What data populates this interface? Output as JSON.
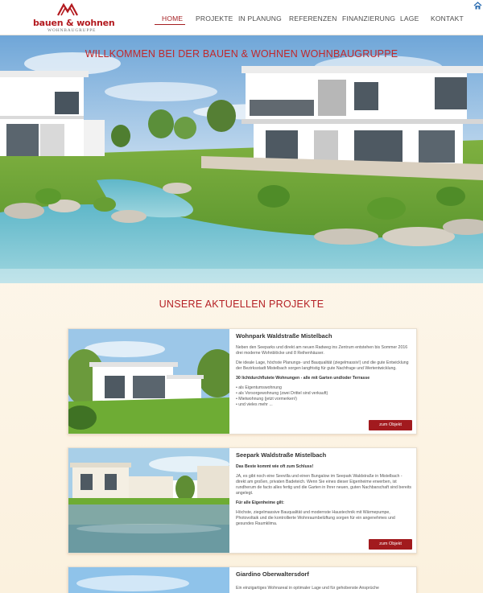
{
  "brand": {
    "name": "bauen & wohnen",
    "tagline": "WOHNBAUGRUPPE"
  },
  "nav": {
    "items": [
      {
        "label": "HOME",
        "active": true
      },
      {
        "label": "PROJEKTE",
        "active": false
      },
      {
        "label": "IN PLANUNG",
        "active": false
      },
      {
        "label": "REFERENZEN",
        "active": false
      },
      {
        "label": "FINANZIERUNG",
        "active": false
      },
      {
        "label": "LAGE",
        "active": false
      },
      {
        "label": "KONTAKT",
        "active": false
      }
    ],
    "home_icon": "home-icon"
  },
  "hero": {
    "title": "WILLKOMMEN BEI DER BAUEN & WOHNEN WOHNBAUGRUPPE"
  },
  "section": {
    "title": "UNSERE AKTUELLEN PROJEKTE"
  },
  "projects": [
    {
      "title": "Wohnpark Waldstraße Mistelbach",
      "p1": "Neben den Seeparks und direkt am neuen Radweg ins Zentrum entstehen bis Sommer 2016 drei moderne Wohnblöcke und 8 Reihenhäuser.",
      "p2": "Die ideale Lage, höchste Planungs- und Bauqualität (ziegelmassiv!) und die gute Entwicklung der Bezirksstadt Mistelbach sorgen langfristig für gute Nachfrage und Wertentwicklung.",
      "p3": "30 lichtdurchflutete Wohnungen - alle mit Garten und/oder Terrasse",
      "bullets": [
        "als Eigentumswohnung",
        "als Vorsorgewohnung (zwei Drittel sind verkauft)",
        "Mietwohnung (jetzt vormerken!)",
        "und vieles mehr ..."
      ],
      "button": "zum Objekt"
    },
    {
      "title": "Seepark Waldstraße Mistelbach",
      "p1": "Das Beste kommt wie oft zum Schluss!",
      "p2": "JA, es gibt noch eine Seevilla und einen Bungalow im Seepark Waldstraße in Mistelbach - direkt am großen, privaten Badeteich. Wenn Sie eines dieser Eigenheime erwerben, ist rundherum de facto alles fertig und die Garten in Ihrer neuen, guten Nachbarschaft sind bereits angelegt.",
      "p3": "Für alle Eigenheime gilt:",
      "p4": "Höchste, ziegelmassive Bauqualität und modernste Haustechnik mit Wärmepumpe, Photovoltaik und die kontrollierte Wohnraumbelüftung sorgen für ein angenehmes und gesundes Raumklima.",
      "button": "zum Objekt"
    },
    {
      "title": "Giardino Oberwaltersdorf",
      "p1": "Ein einzigartiges Wohnareal in optimaler Lage und für gehobenste Ansprüche"
    }
  ],
  "colors": {
    "accent": "#a51e22",
    "text": "#4c4c4c",
    "background": "#fdf6ea"
  }
}
